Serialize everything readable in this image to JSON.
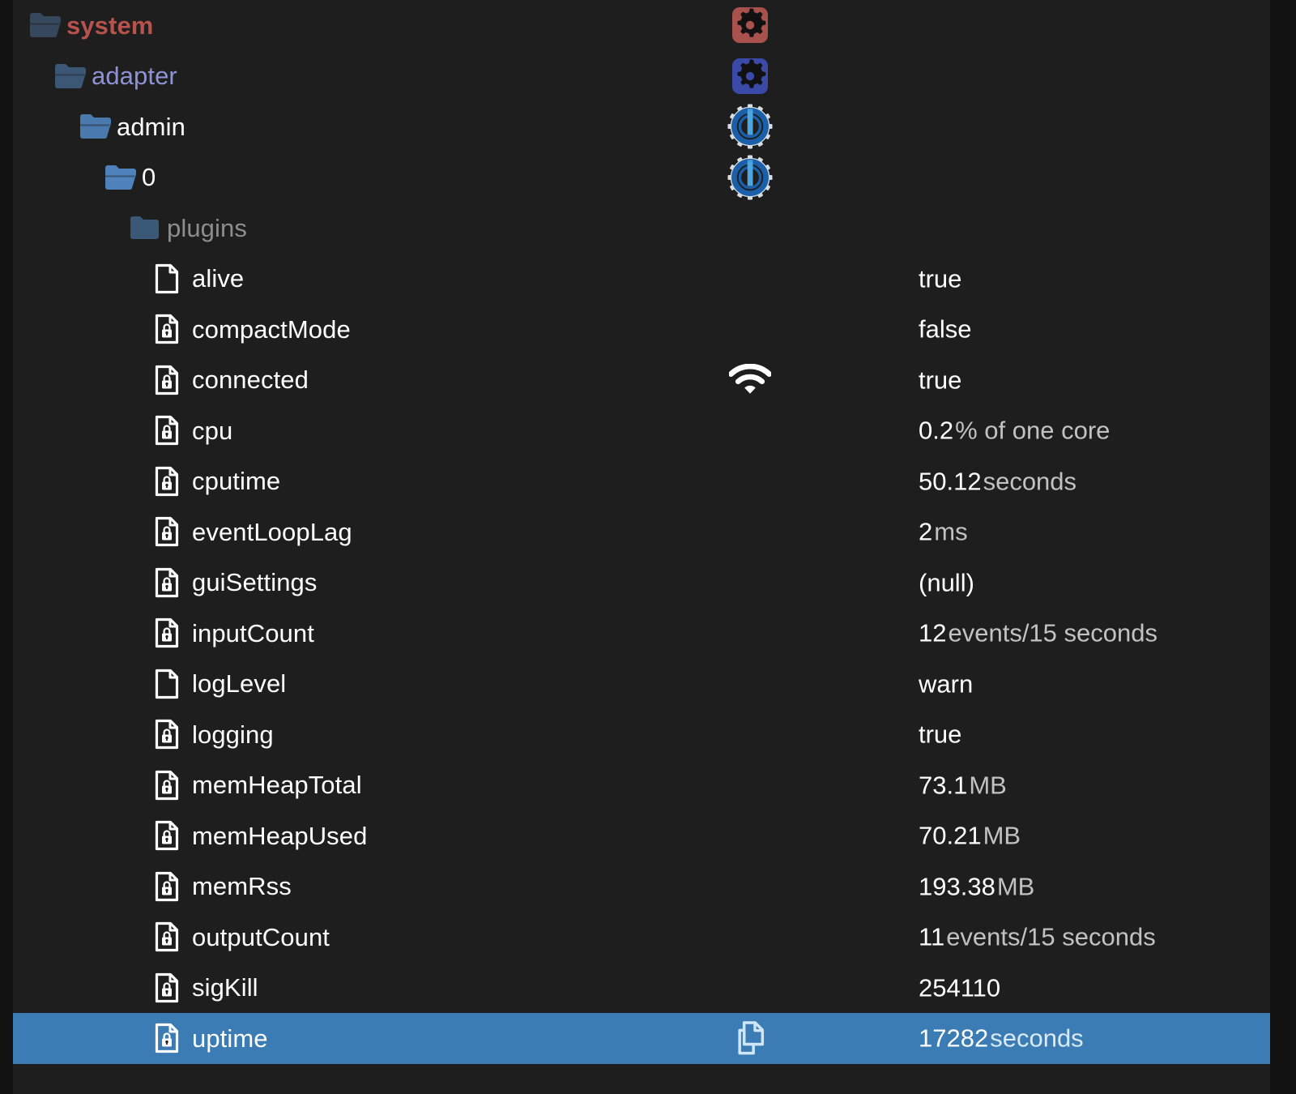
{
  "colors": {
    "background": "#121212",
    "panel": "#1e1e1e",
    "selected_row": "#3a7cb3",
    "system_label": "#b8524d",
    "adapter_label": "#8e93d6",
    "plain_label": "#ffffff",
    "dim_label": "#8d8d8d",
    "null_value": "#b8393a",
    "value_number": "#ffffff",
    "value_unit": "#c2c2c2",
    "badge_red": "#a8514d",
    "badge_blue": "#3b4aa8",
    "iob_ring": "#1a5fa8",
    "iob_bar": "#4da6e0",
    "iob_teeth": "#d6dde2",
    "folder_tier_1": "#35485c",
    "folder_tier_2": "#3c5775",
    "folder_tier_3": "#4a79ad",
    "folder_tier_4": "#4f82ba",
    "folder_closed": "#3a5878"
  },
  "tree": {
    "folders": [
      {
        "name": "system",
        "depth": 0,
        "icon": "folder-open-icon",
        "label_style": "system",
        "folder_tier": 1,
        "mid_icon": "gear-badge-red-icon"
      },
      {
        "name": "adapter",
        "depth": 1,
        "icon": "folder-open-icon",
        "label_style": "adapter",
        "folder_tier": 2,
        "mid_icon": "gear-badge-blue-icon"
      },
      {
        "name": "admin",
        "depth": 2,
        "icon": "folder-open-icon",
        "label_style": "plain",
        "folder_tier": 3,
        "mid_icon": "iobroker-logo-icon"
      },
      {
        "name": "0",
        "depth": 3,
        "icon": "folder-open-icon",
        "label_style": "plain",
        "folder_tier": 4,
        "mid_icon": "iobroker-logo-icon"
      },
      {
        "name": "plugins",
        "depth": 4,
        "icon": "folder-closed-icon",
        "label_style": "dim",
        "folder_tier": 5,
        "mid_icon": null
      }
    ],
    "states": [
      {
        "name": "alive",
        "icon": "document-icon",
        "locked": false,
        "mid_icon": null,
        "value_number": "true",
        "value_unit": "",
        "is_null": false,
        "selected": false
      },
      {
        "name": "compactMode",
        "icon": "document-locked-icon",
        "locked": true,
        "mid_icon": null,
        "value_number": "false",
        "value_unit": "",
        "is_null": false,
        "selected": false
      },
      {
        "name": "connected",
        "icon": "document-locked-icon",
        "locked": true,
        "mid_icon": "wifi-icon",
        "value_number": "true",
        "value_unit": "",
        "is_null": false,
        "selected": false
      },
      {
        "name": "cpu",
        "icon": "document-locked-icon",
        "locked": true,
        "mid_icon": null,
        "value_number": "0.2",
        "value_unit": "% of one core",
        "is_null": false,
        "selected": false
      },
      {
        "name": "cputime",
        "icon": "document-locked-icon",
        "locked": true,
        "mid_icon": null,
        "value_number": "50.12",
        "value_unit": "seconds",
        "is_null": false,
        "selected": false
      },
      {
        "name": "eventLoopLag",
        "icon": "document-locked-icon",
        "locked": true,
        "mid_icon": null,
        "value_number": "2",
        "value_unit": "ms",
        "is_null": false,
        "selected": false
      },
      {
        "name": "guiSettings",
        "icon": "document-locked-icon",
        "locked": true,
        "mid_icon": null,
        "value_number": "(null)",
        "value_unit": "",
        "is_null": true,
        "selected": false
      },
      {
        "name": "inputCount",
        "icon": "document-locked-icon",
        "locked": true,
        "mid_icon": null,
        "value_number": "12",
        "value_unit": "events/15 seconds",
        "is_null": false,
        "selected": false
      },
      {
        "name": "logLevel",
        "icon": "document-icon",
        "locked": false,
        "mid_icon": null,
        "value_number": "warn",
        "value_unit": "",
        "is_null": false,
        "selected": false
      },
      {
        "name": "logging",
        "icon": "document-locked-icon",
        "locked": true,
        "mid_icon": null,
        "value_number": "true",
        "value_unit": "",
        "is_null": false,
        "selected": false
      },
      {
        "name": "memHeapTotal",
        "icon": "document-locked-icon",
        "locked": true,
        "mid_icon": null,
        "value_number": "73.1",
        "value_unit": "MB",
        "is_null": false,
        "selected": false
      },
      {
        "name": "memHeapUsed",
        "icon": "document-locked-icon",
        "locked": true,
        "mid_icon": null,
        "value_number": "70.21",
        "value_unit": "MB",
        "is_null": false,
        "selected": false
      },
      {
        "name": "memRss",
        "icon": "document-locked-icon",
        "locked": true,
        "mid_icon": null,
        "value_number": "193.38",
        "value_unit": "MB",
        "is_null": false,
        "selected": false
      },
      {
        "name": "outputCount",
        "icon": "document-locked-icon",
        "locked": true,
        "mid_icon": null,
        "value_number": "11",
        "value_unit": "events/15 seconds",
        "is_null": false,
        "selected": false
      },
      {
        "name": "sigKill",
        "icon": "document-locked-icon",
        "locked": true,
        "mid_icon": null,
        "value_number": "254110",
        "value_unit": "",
        "is_null": false,
        "selected": false
      },
      {
        "name": "uptime",
        "icon": "document-locked-icon",
        "locked": true,
        "mid_icon": "copy-icon",
        "value_number": "17282",
        "value_unit": "seconds",
        "is_null": false,
        "selected": true
      }
    ]
  }
}
